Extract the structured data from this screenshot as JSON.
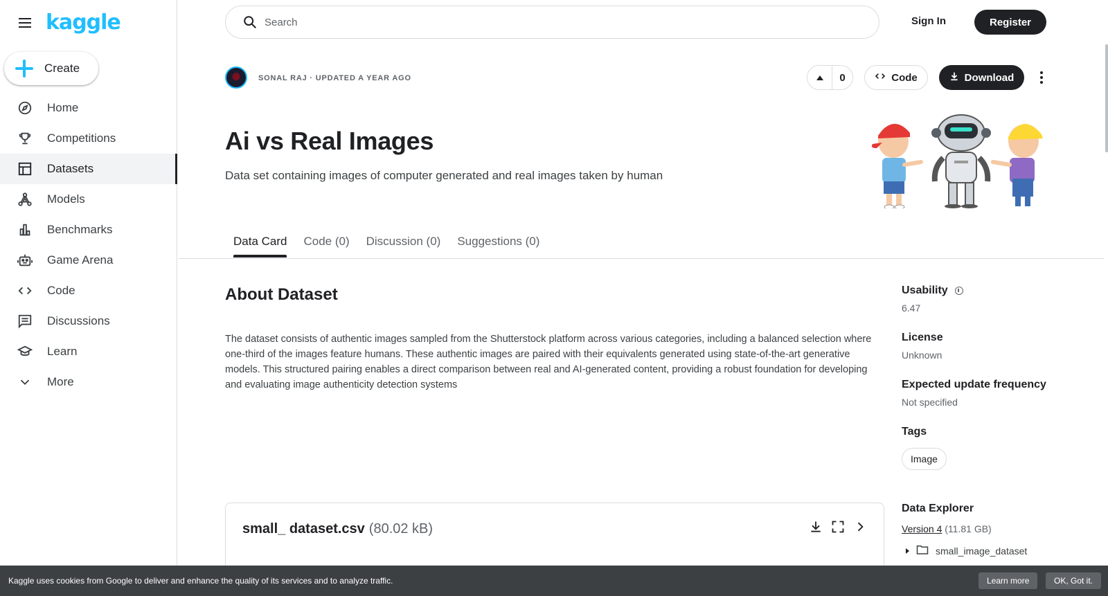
{
  "brand": {
    "logo_text": "kaggle",
    "accent": "#20beff"
  },
  "sidebar": {
    "create_label": "Create",
    "items": [
      {
        "label": "Home",
        "icon": "compass-icon"
      },
      {
        "label": "Competitions",
        "icon": "trophy-icon"
      },
      {
        "label": "Datasets",
        "icon": "table-icon",
        "active": true
      },
      {
        "label": "Models",
        "icon": "models-icon"
      },
      {
        "label": "Benchmarks",
        "icon": "bar-chart-icon"
      },
      {
        "label": "Game Arena",
        "icon": "robot-icon"
      },
      {
        "label": "Code",
        "icon": "code-icon"
      },
      {
        "label": "Discussions",
        "icon": "comment-icon"
      },
      {
        "label": "Learn",
        "icon": "school-icon"
      },
      {
        "label": "More",
        "icon": "chevron-down-icon"
      }
    ]
  },
  "header": {
    "search_placeholder": "Search",
    "sign_in": "Sign In",
    "register": "Register"
  },
  "dataset": {
    "owner_line": "SONAL RAJ · UPDATED A YEAR AGO",
    "upvotes": "0",
    "code_label": "Code",
    "download_label": "Download",
    "title": "Ai vs Real Images",
    "subtitle": "Data set containing images of computer generated and real images taken by human"
  },
  "tabs": [
    {
      "label": "Data Card",
      "active": true
    },
    {
      "label": "Code (0)"
    },
    {
      "label": "Discussion (0)"
    },
    {
      "label": "Suggestions (0)"
    }
  ],
  "about": {
    "heading": "About Dataset",
    "text": "The dataset consists of authentic images sampled from the Shutterstock platform across various categories, including a balanced selection where one-third of the images feature humans. These authentic images are paired with their equivalents generated using state-of-the-art generative models. This structured pairing enables a direct comparison between real and AI-generated content, providing a robust foundation for developing and evaluating image authenticity detection systems"
  },
  "meta": {
    "usability_label": "Usability",
    "usability_value": "6.47",
    "license_label": "License",
    "license_value": "Unknown",
    "frequency_label": "Expected update frequency",
    "frequency_value": "Not specified",
    "tags_label": "Tags",
    "tag": "Image",
    "explorer_label": "Data Explorer",
    "version_label": "Version 4",
    "version_size": "(11.81 GB)",
    "folder": "small_image_dataset"
  },
  "file": {
    "name": "small_ dataset.csv",
    "size": "(80.02 kB)"
  },
  "cookie": {
    "text": "Kaggle uses cookies from Google to deliver and enhance the quality of its services and to analyze traffic.",
    "learn_more": "Learn more",
    "ok": "OK, Got it."
  }
}
